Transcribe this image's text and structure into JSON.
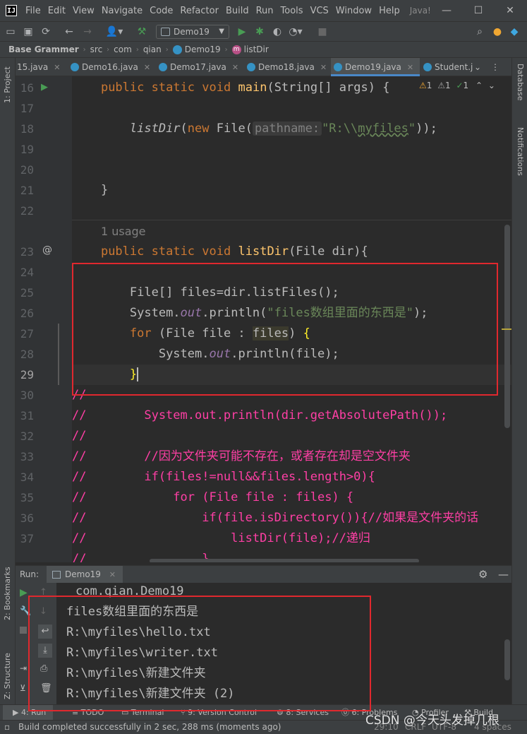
{
  "menu": {
    "items": [
      "File",
      "Edit",
      "View",
      "Navigate",
      "Code",
      "Refactor",
      "Build",
      "Run",
      "Tools",
      "VCS",
      "Window",
      "Help"
    ],
    "title": "Java!"
  },
  "toolbar": {
    "run_config": "Demo19"
  },
  "breadcrumb": {
    "project": "Base Grammer",
    "parts": [
      "src",
      "com",
      "qian",
      "Demo19",
      "listDir"
    ]
  },
  "tabs": [
    "15.java",
    "Demo16.java",
    "Demo17.java",
    "Demo18.java",
    "Demo19.java",
    "Student.j"
  ],
  "left_strip": {
    "project": "1: Project",
    "bookmarks": "2: Bookmarks",
    "structure": "Z: Structure"
  },
  "right_strip": {
    "database": "Database",
    "notifications": "Notifications"
  },
  "inspections": {
    "warn1": "1",
    "warn2": "1",
    "ok": "1"
  },
  "editor": {
    "line_numbers": [
      "16",
      "17",
      "18",
      "19",
      "20",
      "21",
      "22",
      "23",
      "24",
      "25",
      "26",
      "27",
      "28",
      "29",
      "30",
      "31",
      "32",
      "33",
      "34",
      "35",
      "36",
      "37"
    ],
    "usage_hint": "1 usage",
    "kw_public": "public",
    "kw_static": "static",
    "kw_void": "void",
    "kw_new": "new",
    "kw_for": "for",
    "main_name": "main",
    "main_params": "(String[] args) {",
    "call_listdir": "listDir",
    "paren_open": "(",
    "new_file": " File(",
    "param_hint": "pathname:",
    "path_str_pre": "\"R:\\\\",
    "path_str_word": "myfiles",
    "path_str_post": "\"",
    "call_end": "));",
    "close_brace": "}",
    "listdir_name": "listDir",
    "listdir_params": "(File dir){",
    "files_decl": "File[] files=dir.listFiles();",
    "sysout_system": "System.",
    "sysout_out": "out",
    "sysout_println": ".println(",
    "print_str": "\"files数组里面的东西是\"",
    "print_end": ");",
    "for_head": " (File file : ",
    "for_var": "files",
    "for_tail": ") ",
    "for_brace": "{",
    "print_file": ".println(file);",
    "closing_hl": "}",
    "comments": [
      "//",
      "//        System.out.println(dir.getAbsolutePath());",
      "//",
      "//        //因为文件夹可能不存在，或者存在却是空文件夹",
      "//        if(files!=null&&files.length>0){",
      "//            for (File file : files) {",
      "//                if(file.isDirectory()){//如果是文件夹的话",
      "//                    listDir(file);//递归",
      "//                }"
    ]
  },
  "run": {
    "label": "Run:",
    "config": "Demo19",
    "console": [
      "com.qian.Demo19",
      "files数组里面的东西是",
      "R:\\myfiles\\hello.txt",
      "R:\\myfiles\\writer.txt",
      "R:\\myfiles\\新建文件夹",
      "R:\\myfiles\\新建文件夹 (2)"
    ]
  },
  "bottom_tabs": [
    "4: Run",
    "TODO",
    "Terminal",
    "9: Version Control",
    "8: Services",
    "6: Problems",
    "Profiler",
    "Build"
  ],
  "status": {
    "message": "Build completed successfully in 2 sec, 288 ms (moments ago)",
    "position": "29:10",
    "line_sep": "CRLF",
    "encoding": "UTF-8",
    "indent": "4 spaces",
    "watermark": "CSDN @今天头发掉几根"
  }
}
